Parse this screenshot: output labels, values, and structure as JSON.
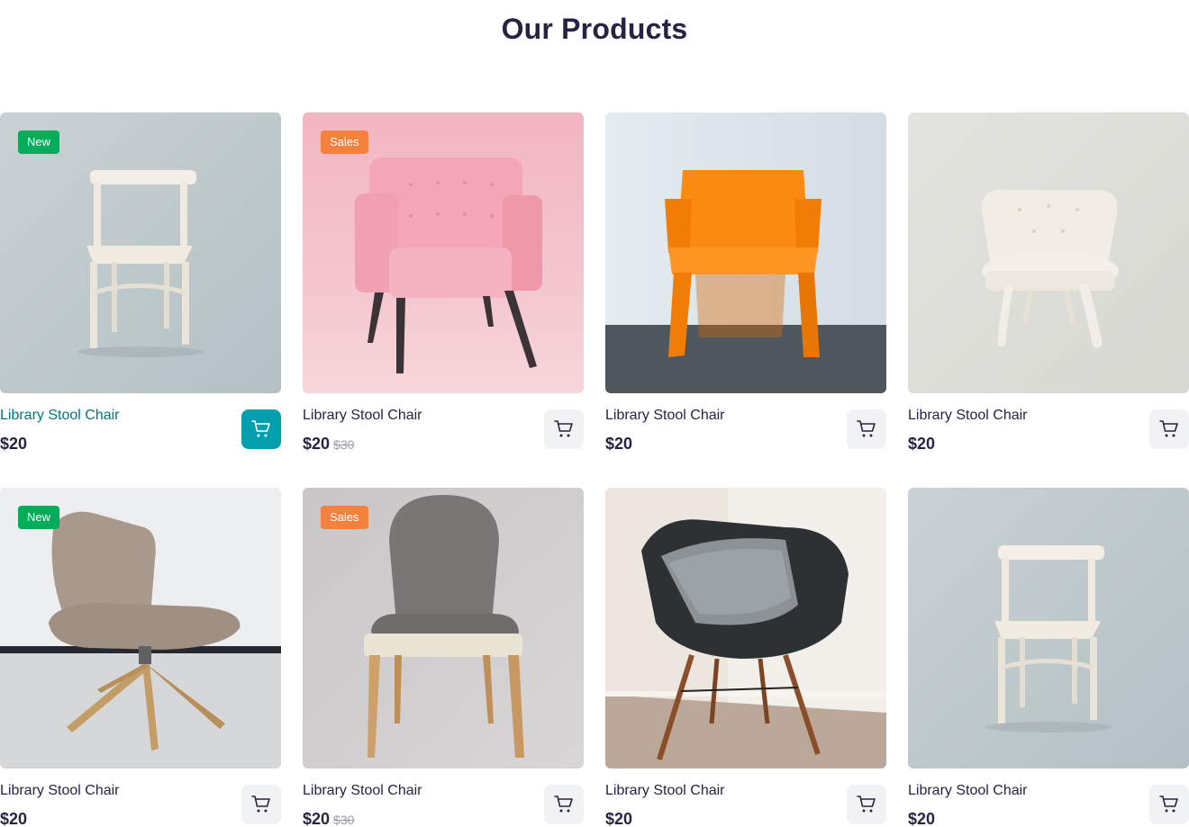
{
  "page": {
    "title": "Our Products"
  },
  "colors": {
    "accent": "#029fae",
    "accent_text": "#007580",
    "new_badge": "#01ad5a",
    "sale_badge": "#f5813f",
    "text": "#272343"
  },
  "products": [
    {
      "name": "Library Stool Chair",
      "price": "$20",
      "old_price": "",
      "badge": "New",
      "image": "white-wooden-chair"
    },
    {
      "name": "Library Stool Chair",
      "price": "$20",
      "old_price": "$30",
      "badge": "Sales",
      "image": "pink-armchair"
    },
    {
      "name": "Library Stool Chair",
      "price": "$20",
      "old_price": "",
      "badge": "",
      "image": "orange-plastic-chair"
    },
    {
      "name": "Library Stool Chair",
      "price": "$20",
      "old_price": "",
      "badge": "",
      "image": "white-tufted-chair"
    },
    {
      "name": "Library Stool Chair",
      "price": "$20",
      "old_price": "",
      "badge": "New",
      "image": "beige-lounge-chair"
    },
    {
      "name": "Library Stool Chair",
      "price": "$20",
      "old_price": "$30",
      "badge": "Sales",
      "image": "grey-dining-chair"
    },
    {
      "name": "Library Stool Chair",
      "price": "$20",
      "old_price": "",
      "badge": "",
      "image": "black-shell-chair-with-pillow"
    },
    {
      "name": "Library Stool Chair",
      "price": "$20",
      "old_price": "",
      "badge": "",
      "image": "white-wooden-chair"
    }
  ]
}
